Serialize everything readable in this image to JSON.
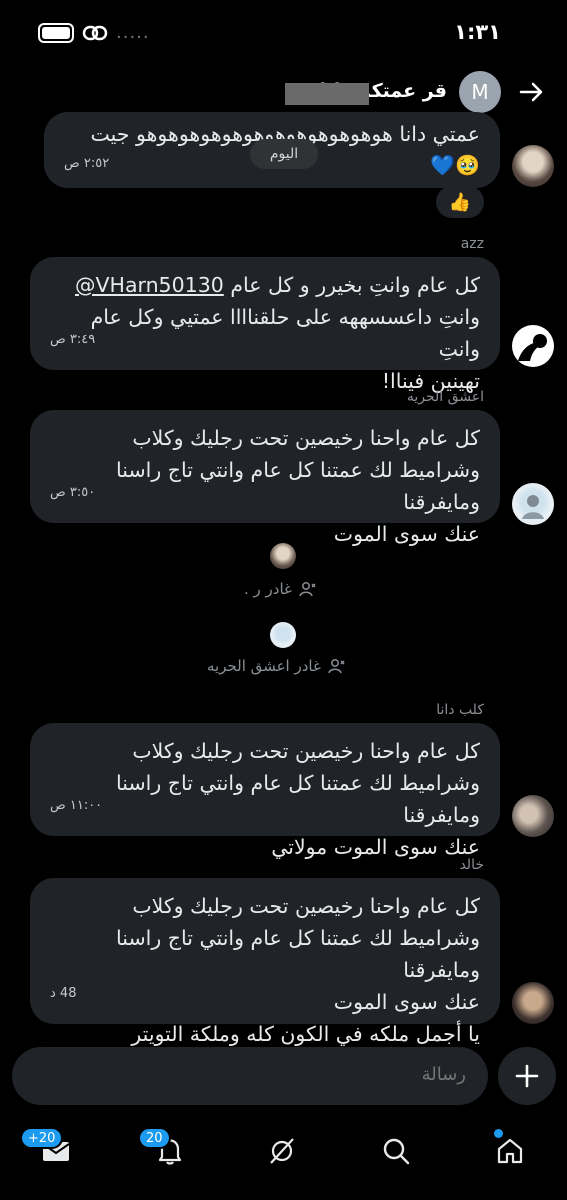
{
  "status": {
    "time": "١:٣١",
    "dots": "....."
  },
  "header": {
    "title": "قر عمتكم دانا",
    "avatar_letter": "M"
  },
  "messages": [
    {
      "text": "عمتي دانا هوهوهوهوهوهوهوهوهوهوهوهو جيت",
      "emoji": "🥹💙",
      "time": "٢:٥٢ ص"
    },
    {
      "sender": "azz",
      "mention": "@VHarn50130",
      "line1_rest": "كل عام وانتِ بخيرر و كل عام",
      "line2": "وانتِ داعسسههه على حلقناااا عمتيي وكل عام وانتِ",
      "line3": "تهينين فيناا!",
      "time": "٣:٤٩ ص"
    },
    {
      "sender": "اعشق الحريه",
      "line1": "كل عام واحنا رخيصين تحت رجليك وكلاب",
      "line2": "وشراميط لك عمتنا كل عام وانتي تاج راسنا ومايفرقنا",
      "line3": "عنك سوى الموت",
      "time": "٣:٥٠ ص"
    },
    {
      "sender": "كلب دانا",
      "line1": "كل عام واحنا رخيصين تحت رجليك وكلاب",
      "line2": "وشراميط لك عمتنا كل عام وانتي تاج راسنا ومايفرقنا",
      "line3": "عنك سوى الموت مولاتي",
      "time": "١١:٠٠ ص"
    },
    {
      "sender": "خالد",
      "line1": "كل عام واحنا رخيصين تحت رجليك وكلاب",
      "line2": "وشراميط لك عمتنا كل عام وانتي تاج راسنا ومايفرقنا",
      "line3": "عنك سوى الموت",
      "line4": "يا أجمل ملكه في الكون كله وملكة التويتر",
      "time": "48 د"
    }
  ],
  "today_label": "اليوم",
  "reaction": "👍",
  "system": [
    {
      "text": "غادر ر ."
    },
    {
      "text": "غادر اعشق الحريه"
    }
  ],
  "composer": {
    "placeholder": "رسالة"
  },
  "tabs": {
    "mail_badge": "+20",
    "notif_badge": "20"
  },
  "colors": {
    "accent": "#1d9bf0",
    "bubble": "#202327",
    "background": "#000000"
  }
}
